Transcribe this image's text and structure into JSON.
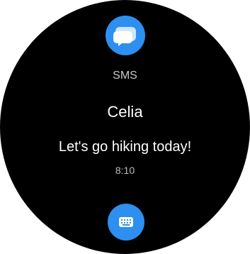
{
  "notification": {
    "app_name": "SMS",
    "app_icon": "message-bubbles-icon",
    "sender": "Celia",
    "message": "Let's go hiking today!",
    "time": "8:10"
  },
  "actions": {
    "reply_icon": "keyboard-icon"
  },
  "colors": {
    "accent": "#2d8ff0",
    "background": "#000000"
  }
}
